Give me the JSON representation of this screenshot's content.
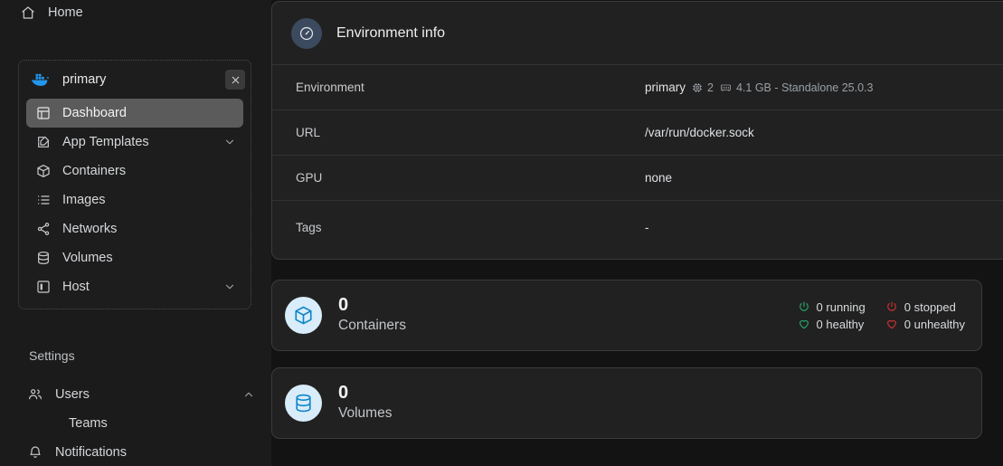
{
  "sidebar": {
    "home": {
      "label": "Home",
      "icon": "home-icon"
    },
    "environment": {
      "name": "primary",
      "logo": "docker-whale-icon",
      "close_icon": "close-icon",
      "items": [
        {
          "label": "Dashboard",
          "icon": "layout-dashboard-icon",
          "active": true,
          "chevron": ""
        },
        {
          "label": "App Templates",
          "icon": "edit-square-icon",
          "active": false,
          "chevron": "chevron-down-icon"
        },
        {
          "label": "Containers",
          "icon": "box-icon",
          "active": false,
          "chevron": ""
        },
        {
          "label": "Images",
          "icon": "list-icon",
          "active": false,
          "chevron": ""
        },
        {
          "label": "Networks",
          "icon": "share-nodes-icon",
          "active": false,
          "chevron": ""
        },
        {
          "label": "Volumes",
          "icon": "database-icon",
          "active": false,
          "chevron": ""
        },
        {
          "label": "Host",
          "icon": "panel-left-icon",
          "active": false,
          "chevron": "chevron-down-icon"
        }
      ]
    },
    "settings_label": "Settings",
    "settings_items": [
      {
        "label": "Users",
        "icon": "users-icon",
        "chevron": "chevron-up-icon",
        "sub": false
      },
      {
        "label": "Teams",
        "icon": "",
        "chevron": "",
        "sub": true
      },
      {
        "label": "Notifications",
        "icon": "bell-icon",
        "chevron": "",
        "sub": false
      }
    ]
  },
  "main": {
    "env_info": {
      "title": "Environment info",
      "title_icon": "gauge-icon",
      "rows": [
        {
          "key": "Environment",
          "value": "primary",
          "cpu_icon": "cpu-icon",
          "cpu": "2",
          "ram_icon": "memory-icon",
          "ram": "4.1 GB - Standalone 25.0.3"
        },
        {
          "key": "URL",
          "value": "/var/run/docker.sock"
        },
        {
          "key": "GPU",
          "value": "none"
        },
        {
          "key": "Tags",
          "value": "-"
        }
      ]
    },
    "containers_card": {
      "count": "0",
      "label": "Containers",
      "icon": "box-3d-icon",
      "statuses": [
        {
          "label": "0 running",
          "icon": "power-icon",
          "color": "#27a567"
        },
        {
          "label": "0 stopped",
          "icon": "power-icon",
          "color": "#cc3232"
        },
        {
          "label": "0 healthy",
          "icon": "heart-icon",
          "color": "#27a567"
        },
        {
          "label": "0 unhealthy",
          "icon": "heart-icon",
          "color": "#cc3232"
        }
      ]
    },
    "volumes_card": {
      "count": "0",
      "label": "Volumes",
      "icon": "database-icon"
    }
  },
  "colors": {
    "sidebar_bg": "#1b1b1b",
    "main_bg": "#131313",
    "card_bg": "#212121",
    "accent_blue": "#1d91d0",
    "docker_blue": "#2396ed",
    "active_row": "#5b5b5b"
  }
}
